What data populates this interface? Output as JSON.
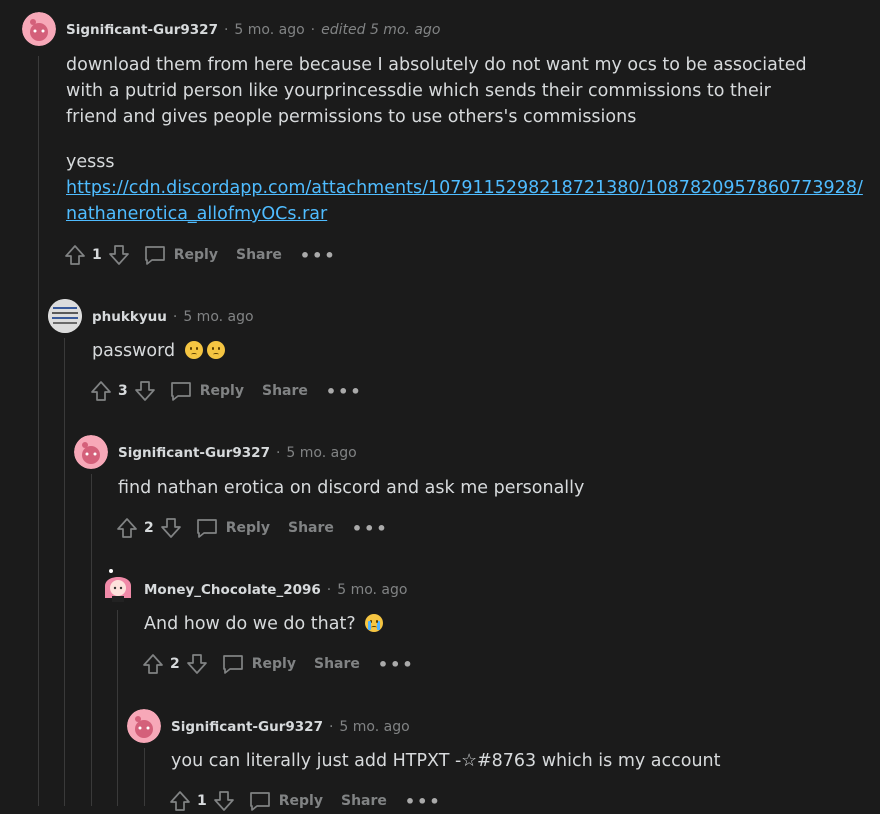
{
  "comments": [
    {
      "author": "Significant-Gur9327",
      "time": "5 mo. ago",
      "edited": "edited 5 mo. ago",
      "body": "download them from here because I absolutely do not want my ocs to be associated with a putrid person like yourprincessdie which sends their commissions to their friend and gives people permissions to use others's commissions",
      "body2": "yesss",
      "link_line1": "https://cdn.discordapp.com/attachments/1079115298218721380/1087820957860773928/",
      "link_line2": "nathanerotica_allofmyOCs.rar",
      "votes": "1"
    },
    {
      "author": "phukkyuu",
      "time": "5 mo. ago",
      "body": "password",
      "votes": "3"
    },
    {
      "author": "Significant-Gur9327",
      "time": "5 mo. ago",
      "body": "find nathan erotica on discord and ask me personally",
      "votes": "2"
    },
    {
      "author": "Money_Chocolate_2096",
      "time": "5 mo. ago",
      "body": "And how do we do that?",
      "votes": "2"
    },
    {
      "author": "Significant-Gur9327",
      "time": "5 mo. ago",
      "body": "you can literally just add HTPXT -☆#8763 which is my account",
      "votes": "1"
    }
  ],
  "actions": {
    "reply": "Reply",
    "share": "Share",
    "more": "•••"
  },
  "colors": {
    "background": "#1b1b1b",
    "text": "#d7dadc",
    "meta": "#818384",
    "link": "#4fbcff",
    "avatar_pink": "#f7a8b8"
  },
  "icons": [
    "upvote-icon",
    "downvote-icon",
    "reply-comment-icon",
    "more-options-icon",
    "emoji-face-icon",
    "crying-emoji-icon"
  ]
}
